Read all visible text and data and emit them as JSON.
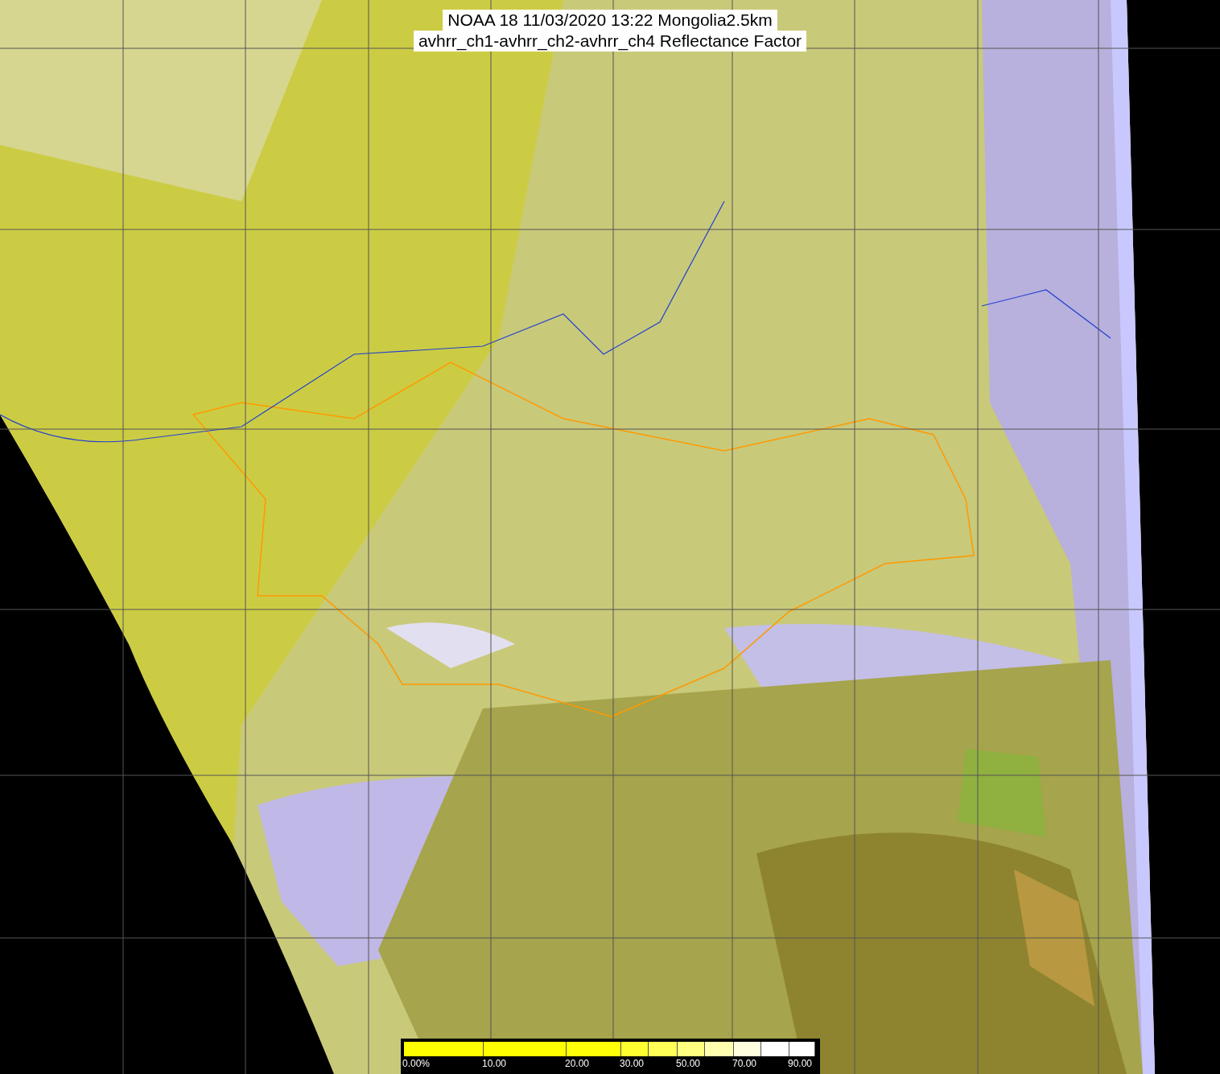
{
  "title_lines": [
    "NOAA 18 11/03/2020 13:22 Mongolia2.5km",
    "avhrr_ch1-avhrr_ch2-avhrr_ch4 Reflectance Factor"
  ],
  "legend": {
    "segments": [
      {
        "color": "#ffff00",
        "label": "0.00%"
      },
      {
        "color": "#ffff00",
        "label": "10.00"
      },
      {
        "color": "#ffff08",
        "label": "20.00"
      },
      {
        "color": "#ffff30",
        "label": "30.00"
      },
      {
        "color": "#ffff55"
      },
      {
        "color": "#ffff80",
        "label": "50.00"
      },
      {
        "color": "#ffffb0"
      },
      {
        "color": "#ffffe0",
        "label": "70.00"
      },
      {
        "color": "#ffffff"
      },
      {
        "color": "#ffffff",
        "label": "90.00"
      }
    ]
  }
}
